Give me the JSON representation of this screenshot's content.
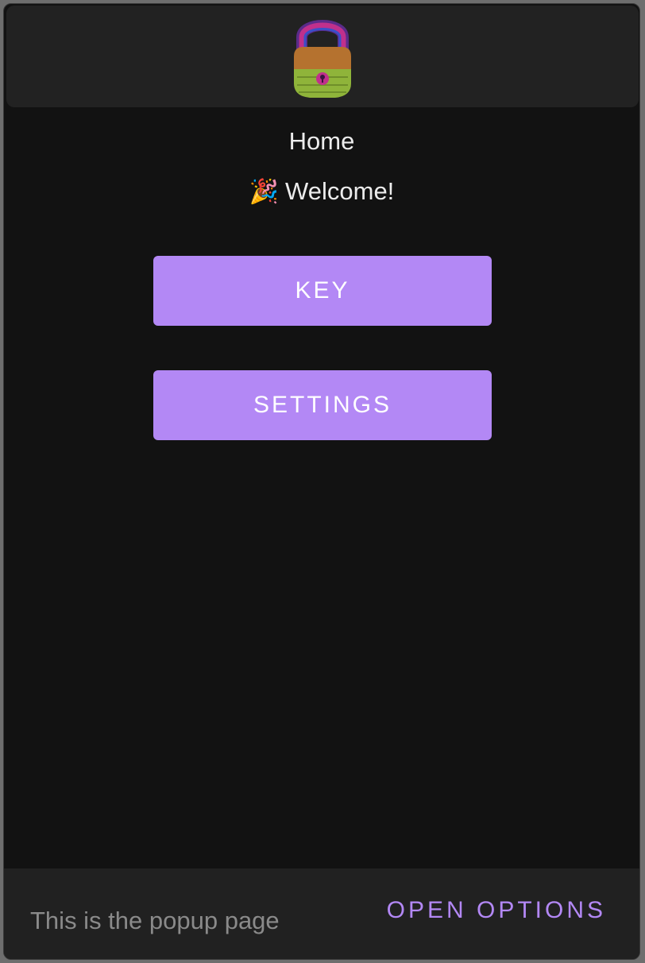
{
  "header": {
    "logo_icon": "padlock-icon"
  },
  "main": {
    "title": "Home",
    "welcome_emoji": "🎉",
    "welcome_text": "Welcome!",
    "buttons": {
      "key_label": "KEY",
      "settings_label": "SETTINGS"
    }
  },
  "footer": {
    "text": "This is the popup page",
    "open_options_label": "OPEN OPTIONS"
  },
  "colors": {
    "accent": "#b388f5",
    "background": "#121212",
    "panel": "#222222",
    "text": "#ececec",
    "muted_text": "#8a8a8a"
  }
}
